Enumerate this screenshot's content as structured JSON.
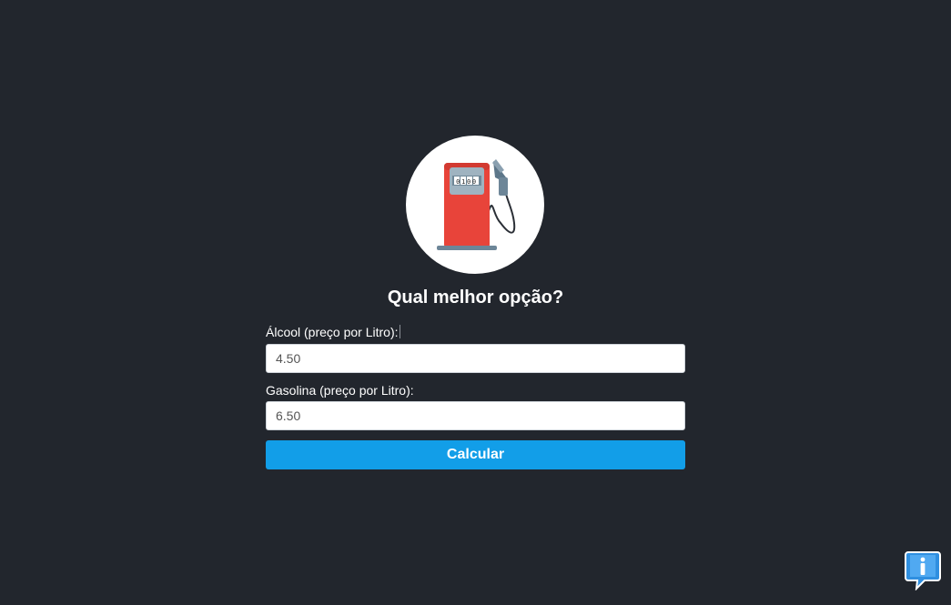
{
  "heading": "Qual melhor opção?",
  "pump_counter": "0100",
  "alcohol": {
    "label": "Álcool (preço por Litro):",
    "value": "4.50"
  },
  "gasoline": {
    "label": "Gasolina (preço por Litro):",
    "value": "6.50"
  },
  "calculate_label": "Calcular",
  "colors": {
    "background": "#22262d",
    "button": "#129ee8",
    "pump_body": "#e8443a"
  },
  "icons": {
    "logo": "fuel-pump-icon",
    "help": "info-icon"
  }
}
